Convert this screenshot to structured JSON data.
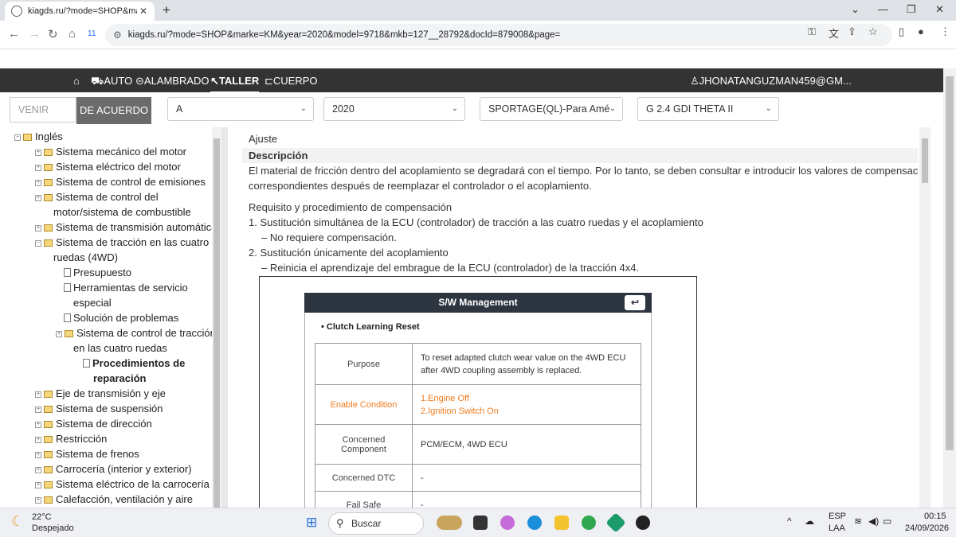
{
  "browser": {
    "tab_title": "kiagds.ru/?mode=SHOP&marke",
    "url": "kiagds.ru/?mode=SHOP&marke=KM&year=2020&model=9718&mkb=127__28792&docId=879008&page=",
    "badge_count": "11"
  },
  "nav": {
    "items": [
      "AUTO",
      "ALAMBRADO",
      "TALLER",
      "CUERPO"
    ],
    "user": "JHONATANGUZMAN459@GM..."
  },
  "selectors": {
    "vin_placeholder": "VENIR",
    "ok_button": "DE ACUERDO",
    "make": "A",
    "year": "2020",
    "model": "SPORTAGE(QL)-Para Amé",
    "engine": "G 2.4 GDI THETA II"
  },
  "tree": {
    "root": "Inglés",
    "items": [
      "Sistema mecánico del motor",
      "Sistema eléctrico del motor",
      "Sistema de control de emisiones",
      "Sistema de control del",
      "motor/sistema de combustible",
      "Sistema de transmisión automática",
      "Sistema de tracción en las cuatro",
      "ruedas (4WD)",
      "Presupuesto",
      "Herramientas de servicio",
      "especial",
      "Solución de problemas",
      "Sistema de control de tracción",
      "en las cuatro ruedas",
      "Procedimientos de",
      "reparación",
      "Eje de transmisión y eje",
      "Sistema de suspensión",
      "Sistema de dirección",
      "Restricción",
      "Sistema de frenos",
      "Carrocería (interior y exterior)",
      "Sistema eléctrico de la carrocería",
      "Calefacción, ventilación y aire"
    ]
  },
  "content": {
    "heading": "Ajuste",
    "desc_label": "Descripción",
    "desc_line1": "El material de fricción dentro del acoplamiento se degradará con el tiempo. Por lo tanto, se deben consultar e introducir los valores de compensación",
    "desc_line2": "correspondientes después de reemplazar el controlador o el acoplamiento.",
    "req_title": "Requisito y procedimiento de compensación",
    "step1": "1. Sustitución simultánea de la ECU (controlador) de tracción a las cuatro ruedas y el acoplamiento",
    "step1_sub": "– No requiere compensación.",
    "step2": "2. Sustitución únicamente del acoplamiento",
    "step2_sub": "– Reinicia el aprendizaje del embrague de la ECU (controlador) de la tracción 4x4."
  },
  "sw": {
    "title": "S/W Management",
    "subtitle": "• Clutch Learning Reset",
    "rows": [
      {
        "k": "Purpose",
        "v1": "To reset adapted clutch wear value on the 4WD ECU",
        "v2": "after 4WD coupling assembly is replaced."
      },
      {
        "k": "Enable Condition",
        "v1": "1.Engine Off",
        "v2": "2.Ignition Switch On"
      },
      {
        "k1": "Concerned",
        "k2": "Component",
        "v1": "PCM/ECM, 4WD ECU"
      },
      {
        "k": "Concerned DTC",
        "v1": "-"
      },
      {
        "k": "Fail Safe",
        "v1": "-"
      }
    ]
  },
  "taskbar": {
    "temp": "22°C",
    "weather": "Despejado",
    "search": "Buscar",
    "lang1": "ESP",
    "lang2": "LAA",
    "time": "00:15",
    "date": "24/09/2026"
  }
}
